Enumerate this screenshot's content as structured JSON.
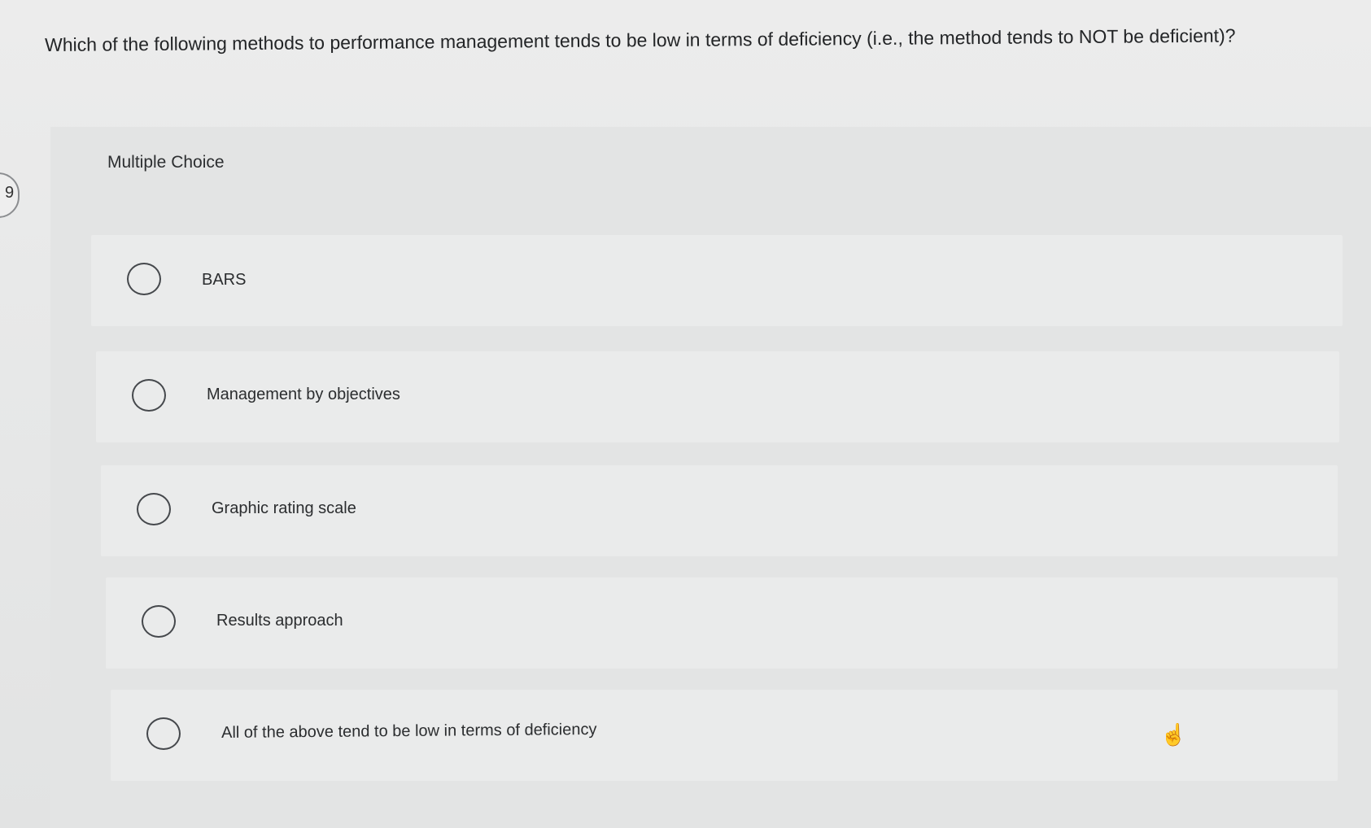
{
  "question": {
    "text": "Which of the following methods to performance management tends to be low in terms of deficiency (i.e., the method tends to NOT be deficient)?"
  },
  "panel": {
    "label": "Multiple Choice"
  },
  "options": [
    {
      "label": "BARS"
    },
    {
      "label": "Management by objectives"
    },
    {
      "label": "Graphic rating scale"
    },
    {
      "label": "Results approach"
    },
    {
      "label": "All of the above tend to be low in terms of deficiency"
    }
  ],
  "side_tab": {
    "label": "9"
  },
  "icons": {
    "radio": "radio-button-empty",
    "cursor": "hand-pointer-icon"
  }
}
